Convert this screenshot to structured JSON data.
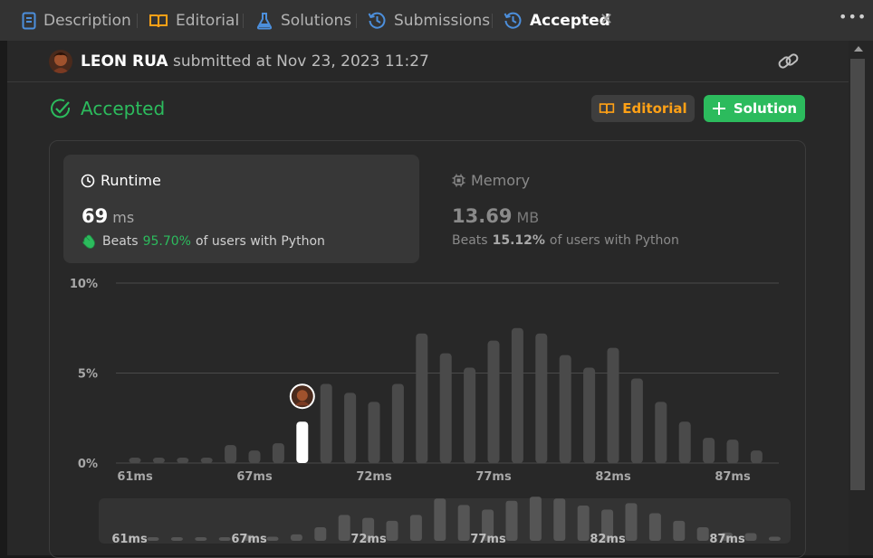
{
  "tabs": [
    {
      "label": "Description",
      "icon": "description-icon"
    },
    {
      "label": "Editorial",
      "icon": "book-icon"
    },
    {
      "label": "Solutions",
      "icon": "flask-icon"
    },
    {
      "label": "Submissions",
      "icon": "history-icon"
    },
    {
      "label": "Accepted",
      "icon": "history-icon",
      "active": true
    }
  ],
  "submission": {
    "user": "LEON RUA",
    "submitted_text": "submitted at Nov 23, 2023 11:27"
  },
  "status": "Accepted",
  "buttons": {
    "editorial": "Editorial",
    "solution": "Solution"
  },
  "runtime": {
    "title": "Runtime",
    "value": "69",
    "unit": "ms",
    "beats_prefix": "Beats",
    "beats_pct": "95.70%",
    "beats_suffix": "of users with Python"
  },
  "memory": {
    "title": "Memory",
    "value": "13.69",
    "unit": "MB",
    "beats_prefix": "Beats",
    "beats_pct": "15.12%",
    "beats_suffix": "of users with Python"
  },
  "colors": {
    "accent_green": "#2cbb5d",
    "accent_orange": "#ffa116",
    "bar": "#4a4a4a",
    "bar_highlight": "#ffffff"
  },
  "chart_data": {
    "type": "bar",
    "y_ticks": [
      "10%",
      "5%",
      "0%"
    ],
    "ylim": [
      0,
      10
    ],
    "x_tick_labels": [
      "61ms",
      "67ms",
      "72ms",
      "77ms",
      "82ms",
      "87ms"
    ],
    "values": [
      0.3,
      0.3,
      0.3,
      0.3,
      1.0,
      0.7,
      1.1,
      2.3,
      4.4,
      3.9,
      3.4,
      4.4,
      7.2,
      6.1,
      5.3,
      6.8,
      7.5,
      7.2,
      6.0,
      5.3,
      6.4,
      4.7,
      3.4,
      2.3,
      1.4,
      1.3,
      0.7
    ],
    "highlight_index": 7,
    "highlight_label": "69ms"
  }
}
